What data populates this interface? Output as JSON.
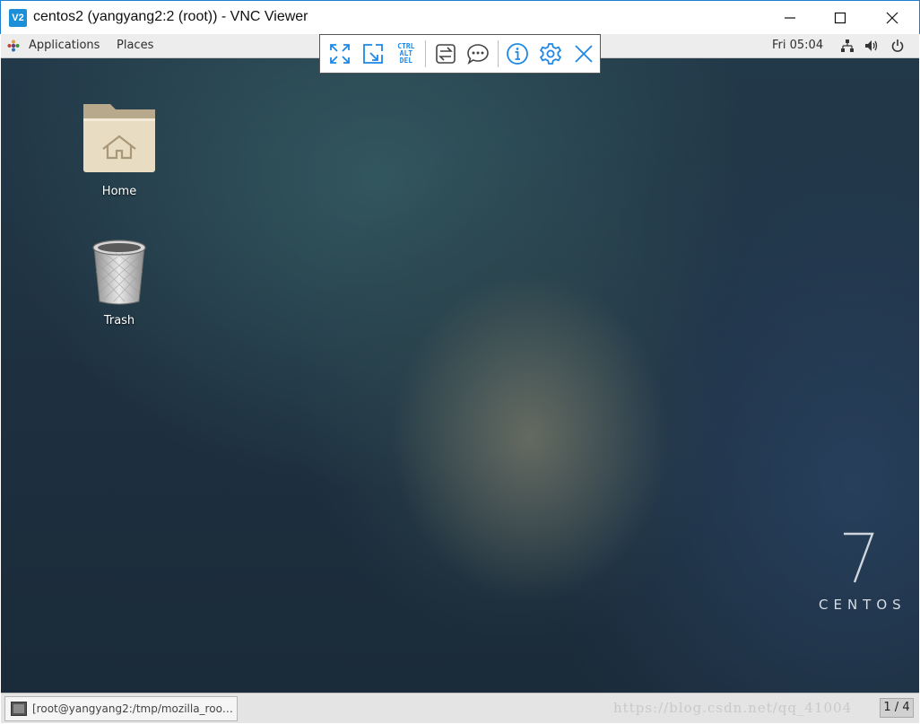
{
  "window": {
    "title": "centos2 (yangyang2:2 (root)) - VNC Viewer",
    "logo_text": "V2"
  },
  "toolbar": {
    "cad_line1": "CTRL",
    "cad_line2": "ALT",
    "cad_line3": "DEL"
  },
  "panel": {
    "applications": "Applications",
    "places": "Places",
    "clock": "Fri 05:04"
  },
  "desktop": {
    "icons": [
      {
        "label": "Home"
      },
      {
        "label": "Trash"
      }
    ]
  },
  "branding": {
    "version": "7",
    "name": "CENTOS"
  },
  "taskbar": {
    "window_item": "[root@yangyang2:/tmp/mozilla_roo…",
    "watermark": "https://blog.csdn.net/qq_41004",
    "workspace": "1 / 4"
  },
  "colors": {
    "accent": "#1e88e5",
    "panel_bg": "#ededed",
    "taskbar_bg": "#e4e4e4"
  }
}
